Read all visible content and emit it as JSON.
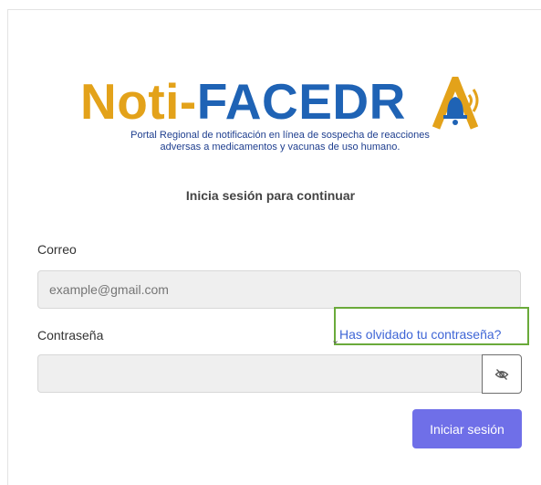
{
  "logo": {
    "part1": "Noti-",
    "part2": "FACEDR",
    "subtitle_line1": "Portal Regional de notificación en línea  de sospecha de reacciones",
    "subtitle_line2": "adversas a medicamentos y vacunas de uso humano.",
    "icon": "bell-icon"
  },
  "colors": {
    "noti": "#e3a21a",
    "facedra": "#1f63b5",
    "primary_button": "#6f6fe8",
    "link": "#3f66d6",
    "highlight_box": "#6aaa3a"
  },
  "form": {
    "subtitle": "Inicia sesión para continuar",
    "email_label": "Correo",
    "email_placeholder": "example@gmail.com",
    "password_label": "Contraseña",
    "forgot_link": "Has olvidado tu contraseña?",
    "toggle_icon": "eye-slash-icon",
    "submit_label": "Iniciar sesión"
  }
}
